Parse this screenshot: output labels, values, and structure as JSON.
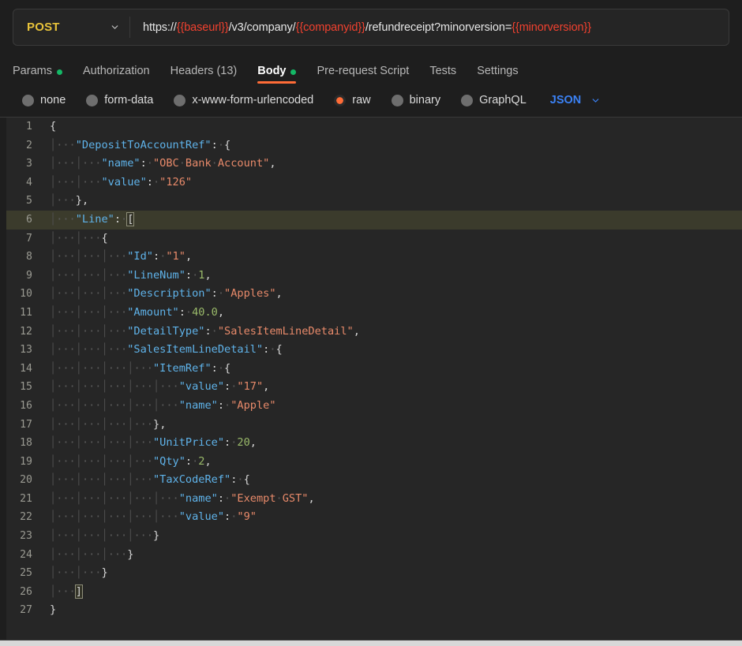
{
  "request": {
    "method": "POST",
    "method_chevron_icon": "chevron-down-icon",
    "url_parts": [
      {
        "text": "https://",
        "type": "plain"
      },
      {
        "text": "{{baseurl}}",
        "type": "variable"
      },
      {
        "text": "/v3/company/",
        "type": "plain"
      },
      {
        "text": "{{companyid}}",
        "type": "variable"
      },
      {
        "text": "/refundreceipt?minorversion=",
        "type": "plain"
      },
      {
        "text": "{{minorversion}}",
        "type": "variable"
      }
    ],
    "url_full": "https://{{baseurl}}/v3/company/{{companyid}}/refundreceipt?minorversion={{minorversion}}"
  },
  "tabs": [
    {
      "label": "Params",
      "active": false,
      "dot": true
    },
    {
      "label": "Authorization",
      "active": false,
      "dot": false
    },
    {
      "label": "Headers (13)",
      "active": false,
      "dot": false
    },
    {
      "label": "Body",
      "active": true,
      "dot": true
    },
    {
      "label": "Pre-request Script",
      "active": false,
      "dot": false
    },
    {
      "label": "Tests",
      "active": false,
      "dot": false
    },
    {
      "label": "Settings",
      "active": false,
      "dot": false
    }
  ],
  "body_types": [
    {
      "label": "none",
      "selected": false
    },
    {
      "label": "form-data",
      "selected": false
    },
    {
      "label": "x-www-form-urlencoded",
      "selected": false
    },
    {
      "label": "raw",
      "selected": true
    },
    {
      "label": "binary",
      "selected": false
    },
    {
      "label": "GraphQL",
      "selected": false
    }
  ],
  "format_select": {
    "value": "JSON",
    "chevron_icon": "chevron-down-icon"
  },
  "colors": {
    "accent_orange": "#ff6c37",
    "method_yellow": "#e8c33a",
    "variable_red": "#f0412f",
    "dot_green": "#14b866",
    "link_blue": "#3b82f6",
    "editor_bg": "#262626",
    "app_bg": "#1e1e1e",
    "active_line": "#3b3b2c",
    "key_blue": "#5fb3ea",
    "string_salmon": "#e88a6a",
    "number_green": "#9aba6a"
  },
  "editor": {
    "language": "json",
    "active_line": 6,
    "total_lines": 27,
    "lines": [
      {
        "num": 1,
        "indent": 0,
        "tokens": [
          {
            "t": "{",
            "c": "p"
          }
        ]
      },
      {
        "num": 2,
        "indent": 1,
        "tokens": [
          {
            "t": "\"DepositToAccountRef\"",
            "c": "k"
          },
          {
            "t": ":",
            "c": "p"
          },
          {
            "t": "·",
            "c": "ws"
          },
          {
            "t": "{",
            "c": "p"
          }
        ]
      },
      {
        "num": 3,
        "indent": 2,
        "tokens": [
          {
            "t": "\"name\"",
            "c": "k"
          },
          {
            "t": ":",
            "c": "p"
          },
          {
            "t": "·",
            "c": "ws"
          },
          {
            "t": "\"OBC·Bank·Account\"",
            "c": "s"
          },
          {
            "t": ",",
            "c": "p"
          }
        ]
      },
      {
        "num": 4,
        "indent": 2,
        "tokens": [
          {
            "t": "\"value\"",
            "c": "k"
          },
          {
            "t": ":",
            "c": "p"
          },
          {
            "t": "·",
            "c": "ws"
          },
          {
            "t": "\"126\"",
            "c": "s"
          }
        ]
      },
      {
        "num": 5,
        "indent": 1,
        "tokens": [
          {
            "t": "}",
            "c": "p"
          },
          {
            "t": ",",
            "c": "p"
          }
        ]
      },
      {
        "num": 6,
        "indent": 1,
        "tokens": [
          {
            "t": "\"Line\"",
            "c": "k"
          },
          {
            "t": ":",
            "c": "p"
          },
          {
            "t": "·",
            "c": "ws"
          },
          {
            "t": "[",
            "c": "brk"
          }
        ]
      },
      {
        "num": 7,
        "indent": 2,
        "tokens": [
          {
            "t": "{",
            "c": "p"
          }
        ]
      },
      {
        "num": 8,
        "indent": 3,
        "tokens": [
          {
            "t": "\"Id\"",
            "c": "k"
          },
          {
            "t": ":",
            "c": "p"
          },
          {
            "t": "·",
            "c": "ws"
          },
          {
            "t": "\"1\"",
            "c": "s"
          },
          {
            "t": ",",
            "c": "p"
          }
        ]
      },
      {
        "num": 9,
        "indent": 3,
        "tokens": [
          {
            "t": "\"LineNum\"",
            "c": "k"
          },
          {
            "t": ":",
            "c": "p"
          },
          {
            "t": "·",
            "c": "ws"
          },
          {
            "t": "1",
            "c": "n"
          },
          {
            "t": ",",
            "c": "p"
          }
        ]
      },
      {
        "num": 10,
        "indent": 3,
        "tokens": [
          {
            "t": "\"Description\"",
            "c": "k"
          },
          {
            "t": ":",
            "c": "p"
          },
          {
            "t": "·",
            "c": "ws"
          },
          {
            "t": "\"Apples\"",
            "c": "s"
          },
          {
            "t": ",",
            "c": "p"
          }
        ]
      },
      {
        "num": 11,
        "indent": 3,
        "tokens": [
          {
            "t": "\"Amount\"",
            "c": "k"
          },
          {
            "t": ":",
            "c": "p"
          },
          {
            "t": "·",
            "c": "ws"
          },
          {
            "t": "40.0",
            "c": "n"
          },
          {
            "t": ",",
            "c": "p"
          }
        ]
      },
      {
        "num": 12,
        "indent": 3,
        "tokens": [
          {
            "t": "\"DetailType\"",
            "c": "k"
          },
          {
            "t": ":",
            "c": "p"
          },
          {
            "t": "·",
            "c": "ws"
          },
          {
            "t": "\"SalesItemLineDetail\"",
            "c": "s"
          },
          {
            "t": ",",
            "c": "p"
          }
        ]
      },
      {
        "num": 13,
        "indent": 3,
        "tokens": [
          {
            "t": "\"SalesItemLineDetail\"",
            "c": "k"
          },
          {
            "t": ":",
            "c": "p"
          },
          {
            "t": "·",
            "c": "ws"
          },
          {
            "t": "{",
            "c": "p"
          }
        ]
      },
      {
        "num": 14,
        "indent": 4,
        "tokens": [
          {
            "t": "\"ItemRef\"",
            "c": "k"
          },
          {
            "t": ":",
            "c": "p"
          },
          {
            "t": "·",
            "c": "ws"
          },
          {
            "t": "{",
            "c": "p"
          }
        ]
      },
      {
        "num": 15,
        "indent": 5,
        "tokens": [
          {
            "t": "\"value\"",
            "c": "k"
          },
          {
            "t": ":",
            "c": "p"
          },
          {
            "t": "·",
            "c": "ws"
          },
          {
            "t": "\"17\"",
            "c": "s"
          },
          {
            "t": ",",
            "c": "p"
          }
        ]
      },
      {
        "num": 16,
        "indent": 5,
        "tokens": [
          {
            "t": "\"name\"",
            "c": "k"
          },
          {
            "t": ":",
            "c": "p"
          },
          {
            "t": "·",
            "c": "ws"
          },
          {
            "t": "\"Apple\"",
            "c": "s"
          }
        ]
      },
      {
        "num": 17,
        "indent": 4,
        "tokens": [
          {
            "t": "}",
            "c": "p"
          },
          {
            "t": ",",
            "c": "p"
          }
        ]
      },
      {
        "num": 18,
        "indent": 4,
        "tokens": [
          {
            "t": "\"UnitPrice\"",
            "c": "k"
          },
          {
            "t": ":",
            "c": "p"
          },
          {
            "t": "·",
            "c": "ws"
          },
          {
            "t": "20",
            "c": "n"
          },
          {
            "t": ",",
            "c": "p"
          }
        ]
      },
      {
        "num": 19,
        "indent": 4,
        "tokens": [
          {
            "t": "\"Qty\"",
            "c": "k"
          },
          {
            "t": ":",
            "c": "p"
          },
          {
            "t": "·",
            "c": "ws"
          },
          {
            "t": "2",
            "c": "n"
          },
          {
            "t": ",",
            "c": "p"
          }
        ]
      },
      {
        "num": 20,
        "indent": 4,
        "tokens": [
          {
            "t": "\"TaxCodeRef\"",
            "c": "k"
          },
          {
            "t": ":",
            "c": "p"
          },
          {
            "t": "·",
            "c": "ws"
          },
          {
            "t": "{",
            "c": "p"
          }
        ]
      },
      {
        "num": 21,
        "indent": 5,
        "tokens": [
          {
            "t": "\"name\"",
            "c": "k"
          },
          {
            "t": ":",
            "c": "p"
          },
          {
            "t": "·",
            "c": "ws"
          },
          {
            "t": "\"Exempt·GST\"",
            "c": "s"
          },
          {
            "t": ",",
            "c": "p"
          }
        ]
      },
      {
        "num": 22,
        "indent": 5,
        "tokens": [
          {
            "t": "\"value\"",
            "c": "k"
          },
          {
            "t": ":",
            "c": "p"
          },
          {
            "t": "·",
            "c": "ws"
          },
          {
            "t": "\"9\"",
            "c": "s"
          }
        ]
      },
      {
        "num": 23,
        "indent": 4,
        "tokens": [
          {
            "t": "}",
            "c": "p"
          }
        ]
      },
      {
        "num": 24,
        "indent": 3,
        "tokens": [
          {
            "t": "}",
            "c": "p"
          }
        ]
      },
      {
        "num": 25,
        "indent": 2,
        "tokens": [
          {
            "t": "}",
            "c": "p"
          }
        ]
      },
      {
        "num": 26,
        "indent": 1,
        "tokens": [
          {
            "t": "]",
            "c": "brk"
          }
        ]
      },
      {
        "num": 27,
        "indent": 0,
        "tokens": [
          {
            "t": "}",
            "c": "p"
          }
        ]
      }
    ]
  }
}
